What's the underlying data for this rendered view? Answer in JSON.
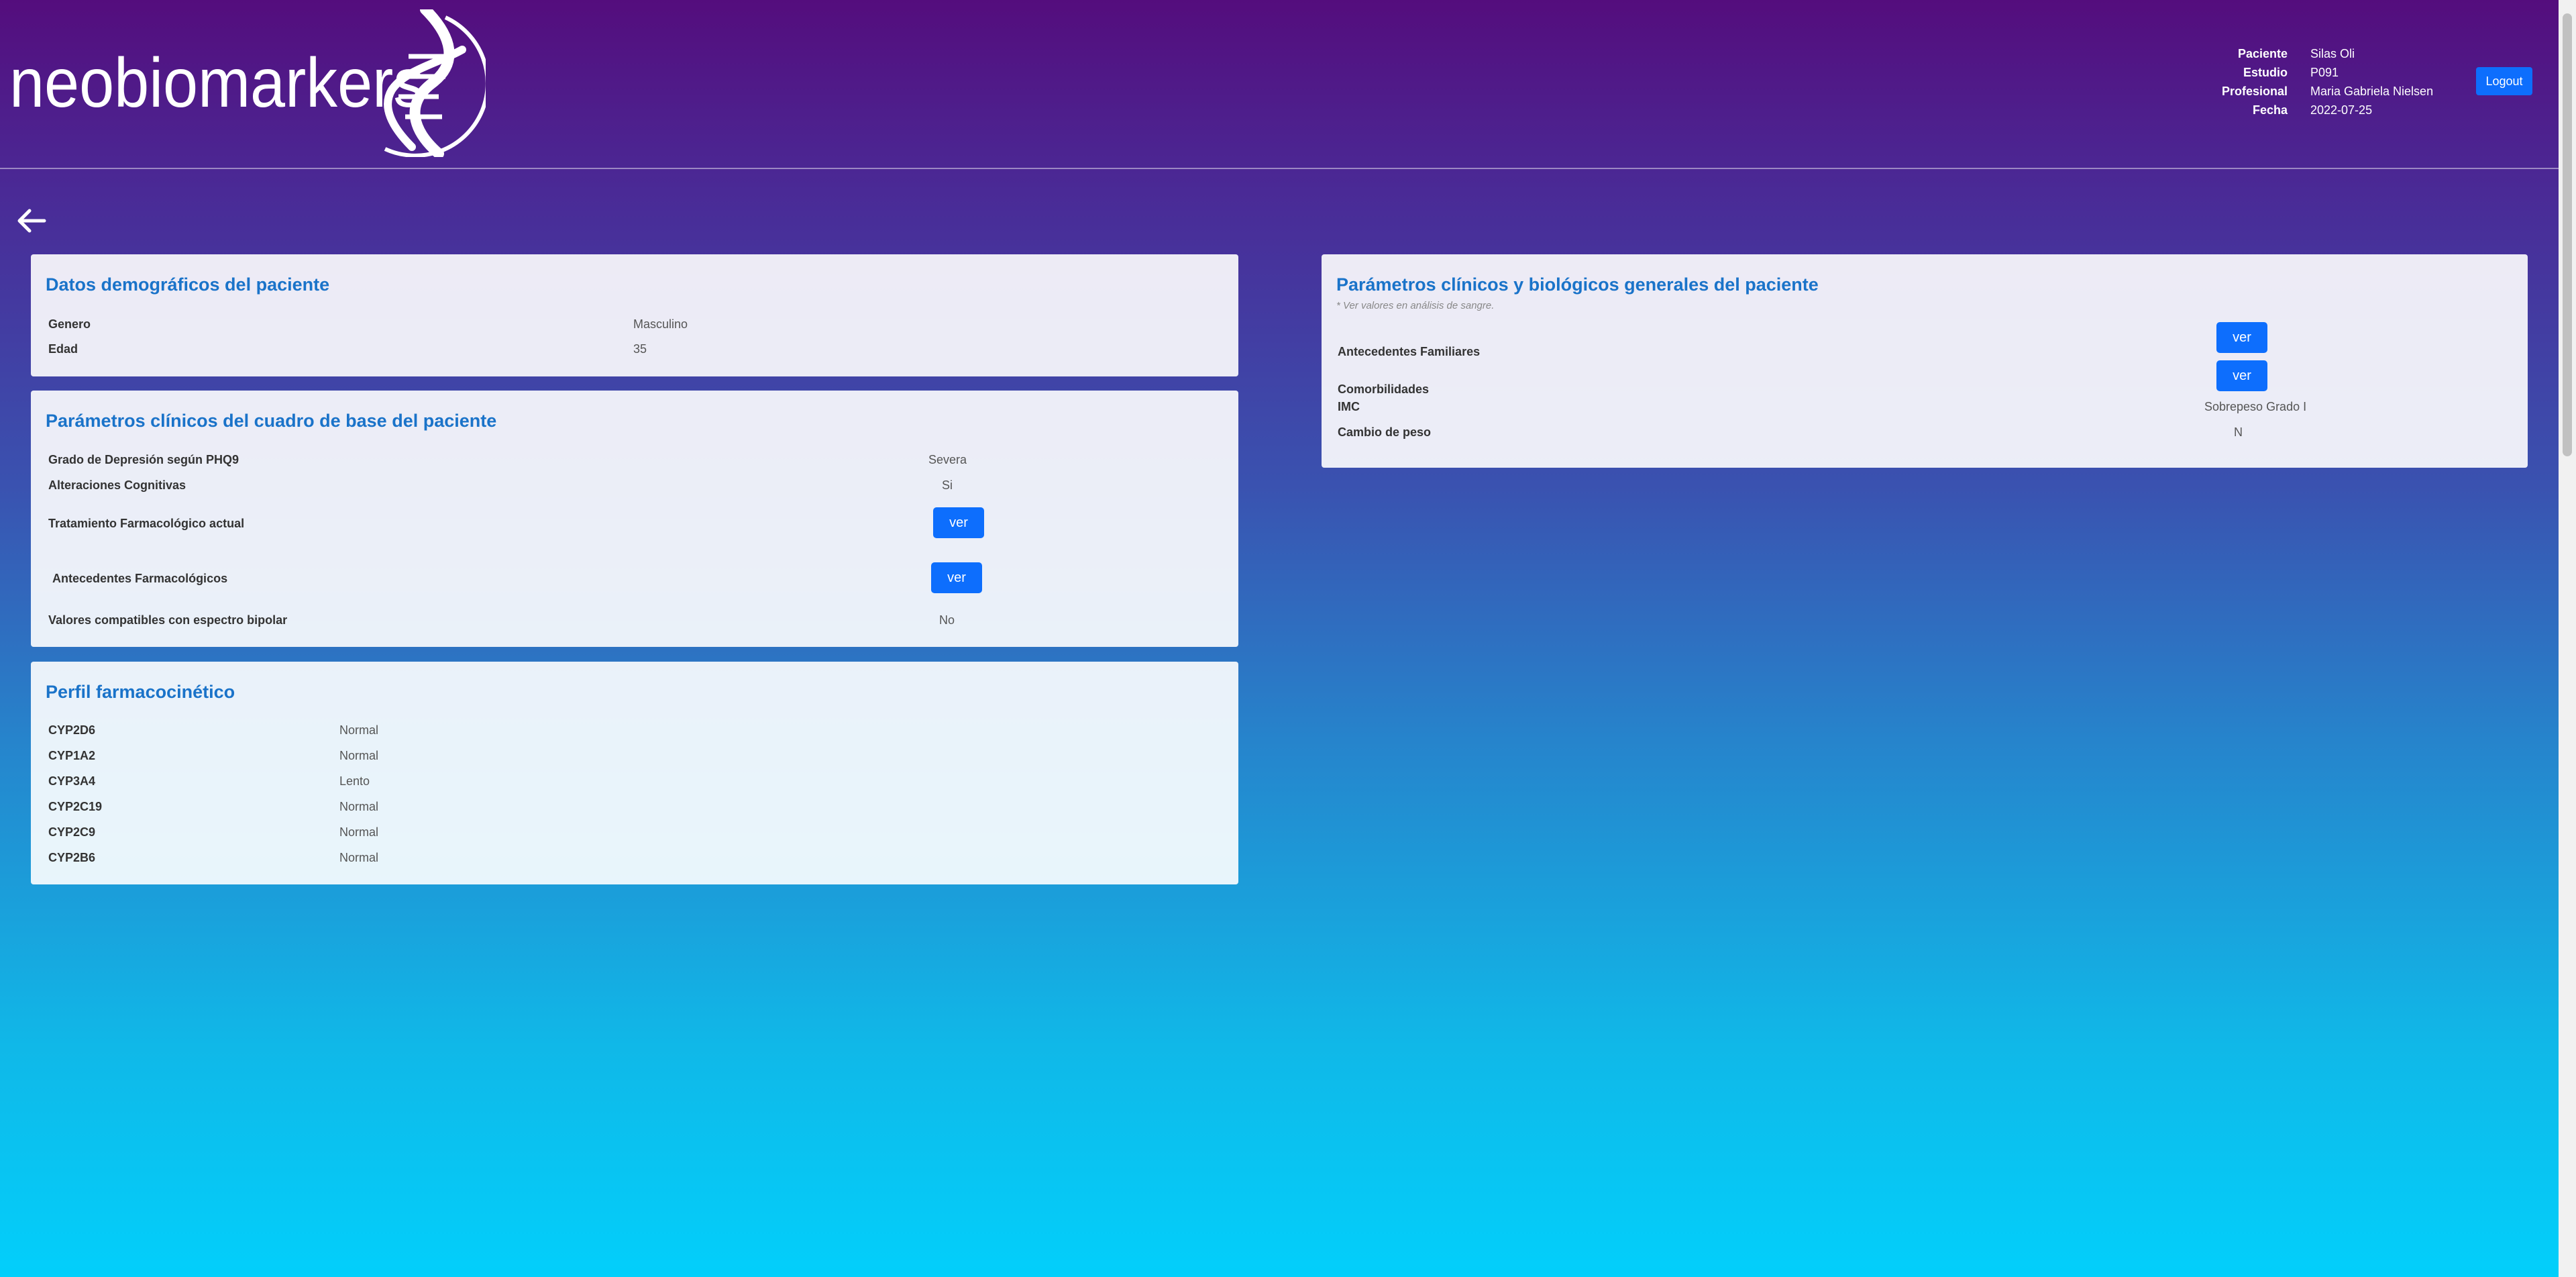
{
  "brand": {
    "name": "neobiomarkers"
  },
  "header": {
    "info": [
      {
        "label": "Paciente",
        "value": "Silas Oli"
      },
      {
        "label": "Estudio",
        "value": "P091"
      },
      {
        "label": "Profesional",
        "value": "Maria Gabriela Nielsen"
      },
      {
        "label": "Fecha",
        "value": "2022-07-25"
      }
    ],
    "logout_label": "Logout"
  },
  "demographics": {
    "title": "Datos demográficos del paciente",
    "rows": [
      {
        "label": "Genero",
        "value": "Masculino"
      },
      {
        "label": "Edad",
        "value": "35"
      }
    ]
  },
  "clinical_base": {
    "title": "Parámetros clínicos del cuadro de base del paciente",
    "rows": [
      {
        "label": "Grado de Depresión según PHQ9",
        "value": "Severa"
      },
      {
        "label": "Alteraciones Cognitivas",
        "value": "Si"
      },
      {
        "label": "Tratamiento Farmacológico actual",
        "button": "ver"
      },
      {
        "label": "Antecedentes Farmacológicos",
        "button": "ver"
      },
      {
        "label": "Valores compatibles con espectro bipolar",
        "value": "No"
      }
    ]
  },
  "pk_profile": {
    "title": "Perfil farmacocinético",
    "rows": [
      {
        "label": "CYP2D6",
        "value": "Normal"
      },
      {
        "label": "CYP1A2",
        "value": "Normal"
      },
      {
        "label": "CYP3A4",
        "value": "Lento"
      },
      {
        "label": "CYP2C19",
        "value": "Normal"
      },
      {
        "label": "CYP2C9",
        "value": "Normal"
      },
      {
        "label": "CYP2B6",
        "value": "Normal"
      }
    ]
  },
  "general_params": {
    "title": "Parámetros clínicos y biológicos generales del paciente",
    "note": "* Ver valores en análisis de sangre.",
    "rows": [
      {
        "label": "Antecedentes Familiares",
        "button": "ver"
      },
      {
        "label": "Comorbilidades",
        "button": "ver"
      },
      {
        "label": "IMC",
        "value": "Sobrepeso Grado I"
      },
      {
        "label": "Cambio de peso",
        "value": "N"
      }
    ]
  },
  "colors": {
    "accent": "#0d6efd",
    "heading": "#1a73c9"
  },
  "icons": {
    "back": "arrow-left-icon",
    "logo": "dna-helix-icon"
  }
}
